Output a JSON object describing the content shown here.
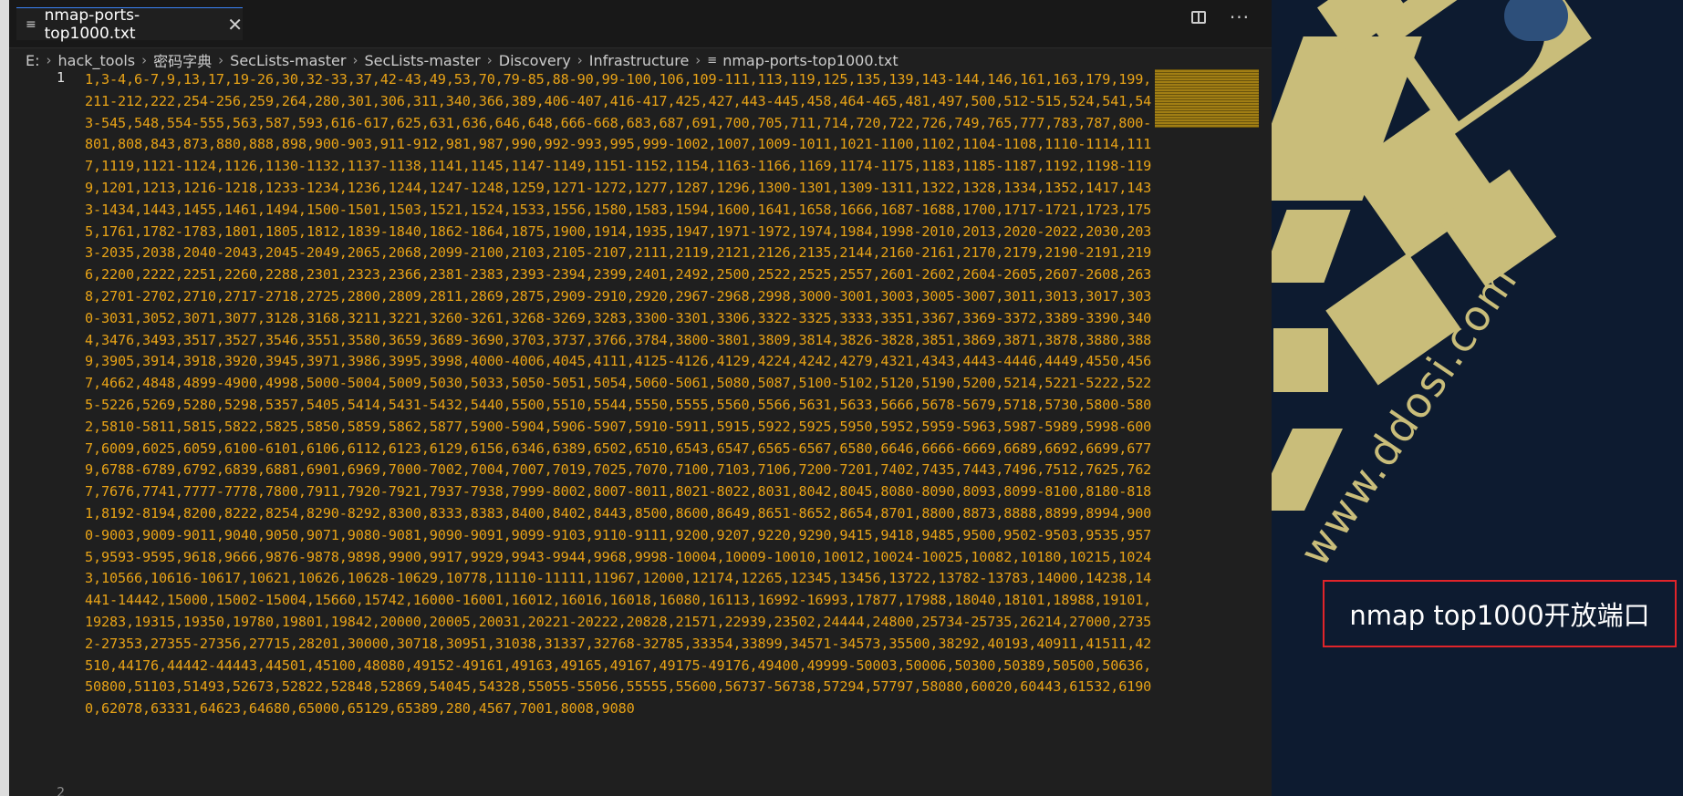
{
  "editor": {
    "tab": {
      "label": "nmap-ports-top1000.txt",
      "close_glyph": "✕"
    },
    "breadcrumb": [
      "E:",
      "hack_tools",
      "密码字典",
      "SecLists-master",
      "SecLists-master",
      "Discovery",
      "Infrastructure",
      "nmap-ports-top1000.txt"
    ],
    "line_numbers": [
      "1",
      "2"
    ],
    "content": "1,3-4,6-7,9,13,17,19-26,30,32-33,37,42-43,49,53,70,79-85,88-90,99-100,106,109-111,113,119,125,135,139,143-144,146,161,163,179,199,211-212,222,254-256,259,264,280,301,306,311,340,366,389,406-407,416-417,425,427,443-445,458,464-465,481,497,500,512-515,524,541,543-545,548,554-555,563,587,593,616-617,625,631,636,646,648,666-668,683,687,691,700,705,711,714,720,722,726,749,765,777,783,787,800-801,808,843,873,880,888,898,900-903,911-912,981,987,990,992-993,995,999-1002,1007,1009-1011,1021-1100,1102,1104-1108,1110-1114,1117,1119,1121-1124,1126,1130-1132,1137-1138,1141,1145,1147-1149,1151-1152,1154,1163-1166,1169,1174-1175,1183,1185-1187,1192,1198-1199,1201,1213,1216-1218,1233-1234,1236,1244,1247-1248,1259,1271-1272,1277,1287,1296,1300-1301,1309-1311,1322,1328,1334,1352,1417,1433-1434,1443,1455,1461,1494,1500-1501,1503,1521,1524,1533,1556,1580,1583,1594,1600,1641,1658,1666,1687-1688,1700,1717-1721,1723,1755,1761,1782-1783,1801,1805,1812,1839-1840,1862-1864,1875,1900,1914,1935,1947,1971-1972,1974,1984,1998-2010,2013,2020-2022,2030,2033-2035,2038,2040-2043,2045-2049,2065,2068,2099-2100,2103,2105-2107,2111,2119,2121,2126,2135,2144,2160-2161,2170,2179,2190-2191,2196,2200,2222,2251,2260,2288,2301,2323,2366,2381-2383,2393-2394,2399,2401,2492,2500,2522,2525,2557,2601-2602,2604-2605,2607-2608,2638,2701-2702,2710,2717-2718,2725,2800,2809,2811,2869,2875,2909-2910,2920,2967-2968,2998,3000-3001,3003,3005-3007,3011,3013,3017,3030-3031,3052,3071,3077,3128,3168,3211,3221,3260-3261,3268-3269,3283,3300-3301,3306,3322-3325,3333,3351,3367,3369-3372,3389-3390,3404,3476,3493,3517,3527,3546,3551,3580,3659,3689-3690,3703,3737,3766,3784,3800-3801,3809,3814,3826-3828,3851,3869,3871,3878,3880,3889,3905,3914,3918,3920,3945,3971,3986,3995,3998,4000-4006,4045,4111,4125-4126,4129,4224,4242,4279,4321,4343,4443-4446,4449,4550,4567,4662,4848,4899-4900,4998,5000-5004,5009,5030,5033,5050-5051,5054,5060-5061,5080,5087,5100-5102,5120,5190,5200,5214,5221-5222,5225-5226,5269,5280,5298,5357,5405,5414,5431-5432,5440,5500,5510,5544,5550,5555,5560,5566,5631,5633,5666,5678-5679,5718,5730,5800-5802,5810-5811,5815,5822,5825,5850,5859,5862,5877,5900-5904,5906-5907,5910-5911,5915,5922,5925,5950,5952,5959-5963,5987-5989,5998-6007,6009,6025,6059,6100-6101,6106,6112,6123,6129,6156,6346,6389,6502,6510,6543,6547,6565-6567,6580,6646,6666-6669,6689,6692,6699,6779,6788-6789,6792,6839,6881,6901,6969,7000-7002,7004,7007,7019,7025,7070,7100,7103,7106,7200-7201,7402,7435,7443,7496,7512,7625,7627,7676,7741,7777-7778,7800,7911,7920-7921,7937-7938,7999-8002,8007-8011,8021-8022,8031,8042,8045,8080-8090,8093,8099-8100,8180-8181,8192-8194,8200,8222,8254,8290-8292,8300,8333,8383,8400,8402,8443,8500,8600,8649,8651-8652,8654,8701,8800,8873,8888,8899,8994,9000-9003,9009-9011,9040,9050,9071,9080-9081,9090-9091,9099-9103,9110-9111,9200,9207,9220,9290,9415,9418,9485,9500,9502-9503,9535,9575,9593-9595,9618,9666,9876-9878,9898,9900,9917,9929,9943-9944,9968,9998-10004,10009-10010,10012,10024-10025,10082,10180,10215,10243,10566,10616-10617,10621,10626,10628-10629,10778,11110-11111,11967,12000,12174,12265,12345,13456,13722,13782-13783,14000,14238,14441-14442,15000,15002-15004,15660,15742,16000-16001,16012,16016,16018,16080,16113,16992-16993,17877,17988,18040,18101,18988,19101,19283,19315,19350,19780,19801,19842,20000,20005,20031,20221-20222,20828,21571,22939,23502,24444,24800,25734-25735,26214,27000,27352-27353,27355-27356,27715,28201,30000,30718,30951,31038,31337,32768-32785,33354,33899,34571-34573,35500,38292,40193,40911,41511,42510,44176,44442-44443,44501,45100,48080,49152-49161,49163,49165,49167,49175-49176,49400,49999-50003,50006,50300,50389,50500,50636,50800,51103,51493,52673,52822,52848,52869,54045,54328,55055-55056,55555,55600,56737-56738,57294,57797,58080,60020,60443,61532,61900,62078,63331,64623,64680,65000,65129,65389,280,4567,7001,8008,9080"
  },
  "icons": {
    "file": "≡",
    "split": "split-editor-icon",
    "more": "···"
  },
  "right_panel": {
    "watermark": "www.ddosi.com",
    "note": "nmap top1000开放端口"
  },
  "colors": {
    "code_text": "#e8a317",
    "editor_bg": "#1f1f1f",
    "panel_bg": "#0d1b30",
    "shape": "#c9bd7a",
    "note_border": "#e0242a"
  }
}
